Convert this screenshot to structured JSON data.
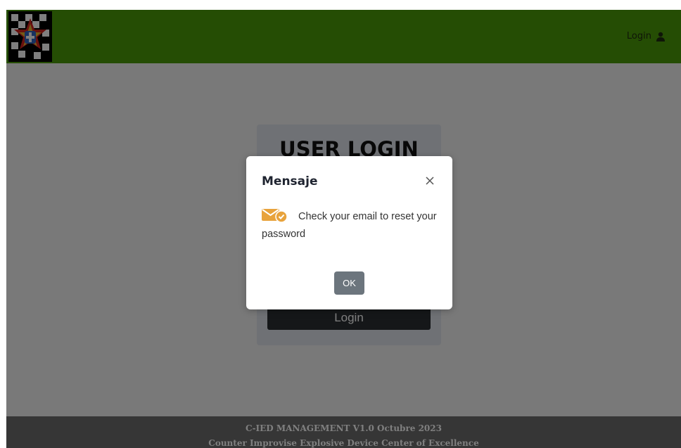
{
  "navbar": {
    "login_label": "Login",
    "logo_icon": "military-crest-logo",
    "user_icon": "user-icon",
    "background_color": "#4a9a08"
  },
  "login_card": {
    "title": "USER LOGIN",
    "login_button_label": "Login"
  },
  "modal": {
    "title": "Mensaje",
    "message": "Check your email to reset your password",
    "ok_label": "OK",
    "close_icon": "close-icon",
    "message_icon": "mail-check-icon",
    "icon_color": "#e8a33c"
  },
  "footer": {
    "line1": "C-IED MANAGEMENT V1.0 Octubre 2023",
    "line2": "Counter Improvise Explosive Device Center of Excellence"
  }
}
